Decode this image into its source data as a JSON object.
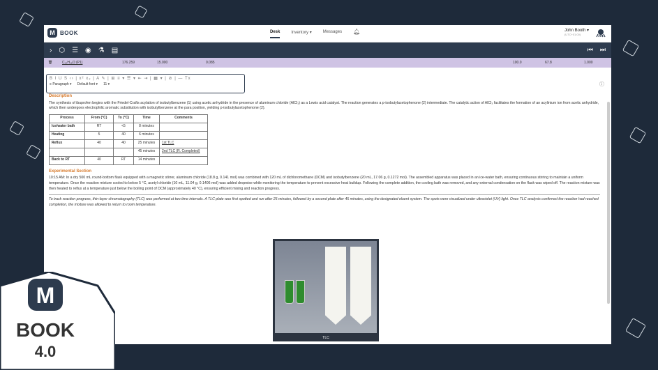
{
  "app": {
    "brand": "BOOK",
    "nav": [
      "Desk",
      "Inventory",
      "Messages"
    ],
    "user_name": "John Booth",
    "user_sub": "(UTC+01:00)"
  },
  "compound": {
    "formula": "C₁₄H₁₈O (P1)",
    "mw": "176.259",
    "mass": "15.000",
    "mmol": "0.085",
    "eq": "100.0",
    "yield": "67.8",
    "v": "1.000"
  },
  "editor": {
    "style": "Paragraph",
    "font": "Default font",
    "size": "11"
  },
  "description": {
    "title": "Description",
    "text": "The synthesis of ibuprofen begins with the Friedel-Crafts acylation of isobutylbenzene (1) using acetic anhydride in the presence of aluminum chloride (AlCl₃) as a Lewis acid catalyst. The reaction generates a p-isobutylacetophenone (2) intermediate. The catalytic action of AlCl₃ facilitates the formation of an acylinium ion from acetic anhydride, which then undergoes electrophilic aromatic substitution with isobutylbenzene at the para position, yielding p-isobutylacetophenone (2)."
  },
  "table": {
    "headers": [
      "Process",
      "From (°C)",
      "To (°C)",
      "Time",
      "Comments"
    ],
    "rows": [
      [
        "Ice/water bath",
        "RT",
        "<5",
        "8 minutes",
        ""
      ],
      [
        "Heating",
        "5",
        "40",
        "6 minutes",
        ""
      ],
      [
        "Reflux",
        "40",
        "40",
        "25 minutes",
        "1st TLC"
      ],
      [
        "",
        "",
        "",
        "45 minutes",
        "2nd TLC (R. Completed)"
      ],
      [
        "Back to RT",
        "40",
        "RT",
        "14 minutes",
        ""
      ]
    ]
  },
  "experimental": {
    "title": "Experimental Section",
    "text": "10:15 AM: In a dry 500 mL round-bottom flask equipped with a magnetic stirrer, aluminum chloride (18.8 g, 0.141 mol) was combined with 120 mL of dichloromethane (DCM) and isobutylbenzene (20 mL, 17.06 g, 0.1272 mol). The assembled apparatus was placed in an ice-water bath, ensuring continuous stirring to maintain a uniform temperature. Once the reaction mixture cooled to below 5 °C, acetyl chloride (10 mL, 11.04 g, 0.1406 mol) was added dropwise while monitoring the temperature to prevent excessive heat buildup. Following the complete addition, the cooling bath was removed, and any external condensation on the flask was wiped off. The reaction mixture was then heated to reflux at a temperature just below the boiling point of DCM (approximately 40 °C), ensuring efficient mixing and reaction progress.",
    "italic": "To track reaction progress, thin-layer chromatography (TLC) was performed at two time intervals. A TLC plate was first spotted and run after 25 minutes, followed by a second plate after 45 minutes, using the designated eluent system. The spots were visualized under ultraviolet (UV) light. Once TLC analysis confirmed the reaction had reached completion, the mixture was allowed to return to room temperature."
  },
  "figure_caption": "TLC",
  "badge": {
    "word": "BOOK",
    "version": "4.0"
  }
}
